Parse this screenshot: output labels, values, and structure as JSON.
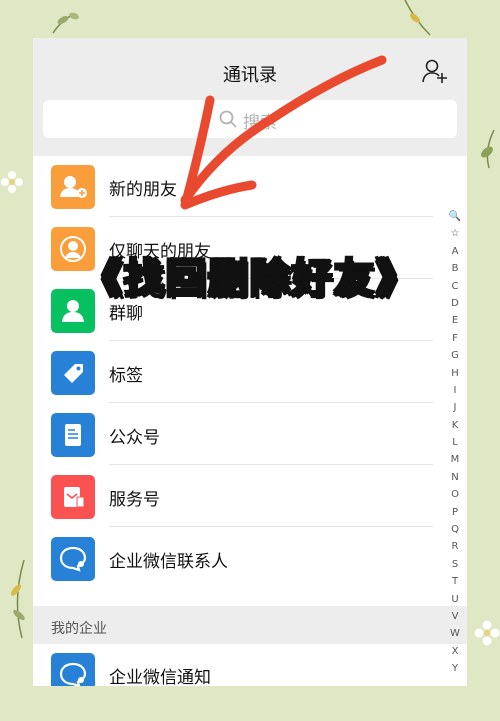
{
  "header": {
    "title": "通讯录"
  },
  "search": {
    "placeholder": "搜索"
  },
  "items": [
    {
      "label": "新的朋友",
      "color": "#fa9d3b",
      "icon": "add-friend-icon"
    },
    {
      "label": "仅聊天的朋友",
      "color": "#fa9d3b",
      "icon": "chat-only-friend-icon"
    },
    {
      "label": "群聊",
      "color": "#07c160",
      "icon": "group-icon"
    },
    {
      "label": "标签",
      "color": "#2782d7",
      "icon": "tag-icon"
    },
    {
      "label": "公众号",
      "color": "#2782d7",
      "icon": "official-account-icon"
    },
    {
      "label": "服务号",
      "color": "#fa5151",
      "icon": "service-account-icon"
    },
    {
      "label": "企业微信联系人",
      "color": "#2782d7",
      "icon": "wecom-contact-icon"
    }
  ],
  "section": {
    "label": "我的企业"
  },
  "enterprise_items": [
    {
      "label": "企业微信通知",
      "color": "#2782d7",
      "icon": "wecom-notify-icon"
    }
  ],
  "index_letters": [
    "🔍",
    "☆",
    "A",
    "B",
    "C",
    "D",
    "E",
    "F",
    "G",
    "H",
    "I",
    "J",
    "K",
    "L",
    "M",
    "N",
    "O",
    "P",
    "Q",
    "R",
    "S",
    "T",
    "U",
    "V",
    "W",
    "X",
    "Y"
  ],
  "overlay": {
    "title": "《找回删除好友》"
  }
}
